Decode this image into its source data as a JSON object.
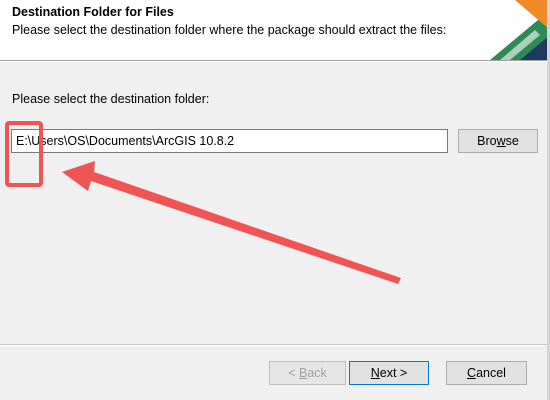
{
  "header": {
    "title": "Destination Folder for Files",
    "description": "Please select the destination folder where the package should extract the files:"
  },
  "main": {
    "prompt": "Please select the destination folder:",
    "path_value": "E:\\Users\\OS\\Documents\\ArcGIS 10.8.2",
    "browse": {
      "pre": "Bro",
      "key": "w",
      "post": "se"
    }
  },
  "footer": {
    "back": {
      "pre": "< ",
      "key": "B",
      "post": "ack"
    },
    "next": {
      "pre": "",
      "key": "N",
      "post": "ext >"
    },
    "cancel": {
      "pre": "",
      "key": "C",
      "post": "ancel"
    }
  },
  "colors": {
    "annotation": "#f05454",
    "logo_green": "#2e8b57",
    "logo_orange": "#f08a24",
    "logo_navy": "#1f3a5f"
  }
}
